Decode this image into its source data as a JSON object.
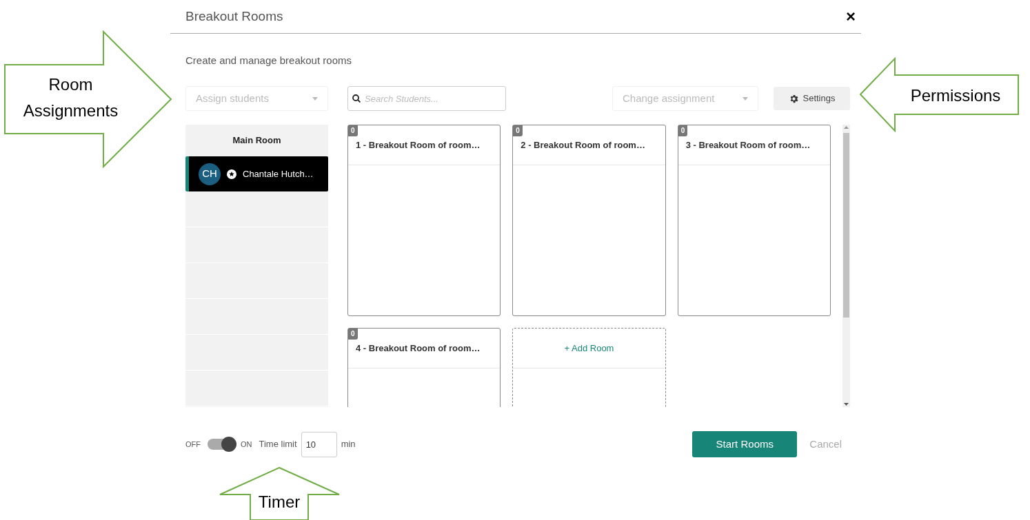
{
  "dialog": {
    "title": "Breakout Rooms",
    "close": "×",
    "subtitle": "Create and manage breakout rooms"
  },
  "toolbar": {
    "assign": "Assign students",
    "search_placeholder": "Search Students...",
    "change": "Change assignment",
    "settings": "Settings"
  },
  "main_room": {
    "title": "Main Room",
    "members": [
      {
        "initials": "CH",
        "name": "Chantale Hutch…",
        "selected": true
      }
    ]
  },
  "rooms": [
    {
      "count": "0",
      "name": "1 - Breakout Room of room…"
    },
    {
      "count": "0",
      "name": "2 - Breakout Room of room…"
    },
    {
      "count": "0",
      "name": "3 - Breakout Room of room…"
    },
    {
      "count": "0",
      "name": "4 - Breakout Room of room…"
    }
  ],
  "add_room": "+ Add Room",
  "footer": {
    "off": "OFF",
    "on_label": "ON",
    "timer_on": true,
    "time_limit_label": "Time limit",
    "time_limit": "10",
    "unit": "min",
    "start": "Start Rooms",
    "cancel": "Cancel"
  },
  "annotations": [
    {
      "kind": "right",
      "text": "Room Assignments"
    },
    {
      "kind": "left",
      "text": "Permissions"
    },
    {
      "kind": "up",
      "text": "Timer"
    }
  ]
}
